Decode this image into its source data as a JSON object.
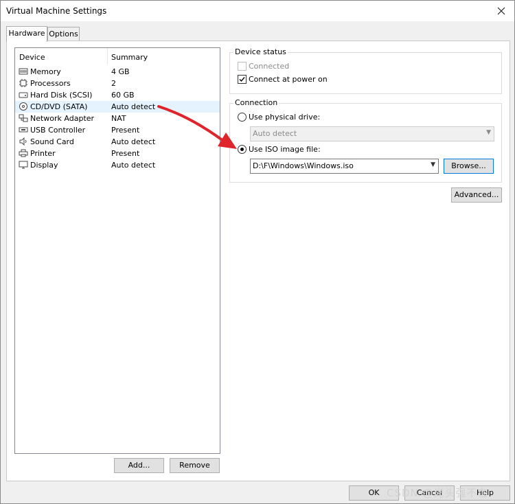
{
  "window": {
    "title": "Virtual Machine Settings"
  },
  "tabs": [
    {
      "label": "Hardware"
    },
    {
      "label": "Options"
    }
  ],
  "device_list": {
    "headers": {
      "device": "Device",
      "summary": "Summary"
    },
    "rows": [
      {
        "device": "Memory",
        "summary": "4 GB",
        "icon": "memory-icon"
      },
      {
        "device": "Processors",
        "summary": "2",
        "icon": "processor-icon"
      },
      {
        "device": "Hard Disk (SCSI)",
        "summary": "60 GB",
        "icon": "hard-disk-icon"
      },
      {
        "device": "CD/DVD (SATA)",
        "summary": "Auto detect",
        "icon": "cd-dvd-icon"
      },
      {
        "device": "Network Adapter",
        "summary": "NAT",
        "icon": "network-adapter-icon"
      },
      {
        "device": "USB Controller",
        "summary": "Present",
        "icon": "usb-icon"
      },
      {
        "device": "Sound Card",
        "summary": "Auto detect",
        "icon": "sound-card-icon"
      },
      {
        "device": "Printer",
        "summary": "Present",
        "icon": "printer-icon"
      },
      {
        "device": "Display",
        "summary": "Auto detect",
        "icon": "display-icon"
      }
    ],
    "selected_index": 3
  },
  "list_buttons": {
    "add": "Add...",
    "remove": "Remove"
  },
  "device_status": {
    "title": "Device status",
    "connected": "Connected",
    "connect_at_power_on": "Connect at power on"
  },
  "connection": {
    "title": "Connection",
    "physical_drive": "Use physical drive:",
    "physical_drive_value": "Auto detect",
    "iso_image": "Use ISO image file:",
    "iso_path": "D:\\F\\Windows\\Windows.iso",
    "browse": "Browse..."
  },
  "advanced": "Advanced...",
  "footer": {
    "ok": "OK",
    "cancel": "Cancel",
    "help": "Help"
  },
  "watermark": "CSDN @光头强不在",
  "colors": {
    "accent_arrow": "#e0242b",
    "selection": "#e5f3ff"
  }
}
